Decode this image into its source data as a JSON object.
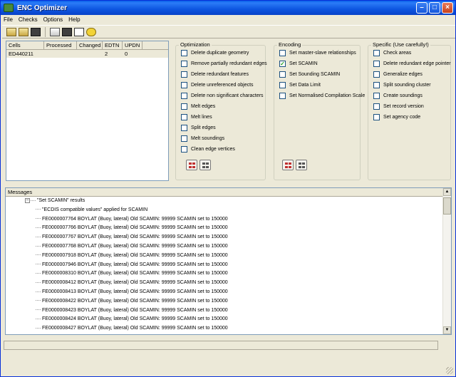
{
  "window": {
    "title": "ENC Optimizer"
  },
  "menu": [
    "File",
    "Checks",
    "Options",
    "Help"
  ],
  "toolbar": {
    "icons": [
      "open-folder-icon",
      "save-icon",
      "stop-icon",
      "run-checks-icon",
      "edit-icon",
      "arrows-icon",
      "help-icon"
    ]
  },
  "cells": {
    "columns": [
      "Cells",
      "Processed",
      "Changed",
      "EDTN",
      "UPDN"
    ],
    "rows": [
      {
        "cell": "ED440211",
        "processed": "",
        "changed": "",
        "edtn": "2",
        "updn": "0"
      }
    ]
  },
  "optimization": {
    "title": "Optimization",
    "options": [
      {
        "label": "Delete duplicate geometry",
        "checked": false
      },
      {
        "label": "Remove partially redundant edges",
        "checked": false
      },
      {
        "label": "Delete redundant features",
        "checked": false
      },
      {
        "label": "Delete unreferenced objects",
        "checked": false
      },
      {
        "label": "Delete non significant characters",
        "checked": false
      },
      {
        "label": "Melt edges",
        "checked": false
      },
      {
        "label": "Melt lines",
        "checked": false
      },
      {
        "label": "Split edges",
        "checked": false
      },
      {
        "label": "Melt soundings",
        "checked": false
      },
      {
        "label": "Clean edge vertices",
        "checked": false
      }
    ]
  },
  "encoding": {
    "title": "Encoding",
    "options": [
      {
        "label": "Set master-slave relationships",
        "checked": false
      },
      {
        "label": "Set SCAMIN",
        "checked": true
      },
      {
        "label": "Set Sounding SCAMIN",
        "checked": false
      },
      {
        "label": "Set Data Limit",
        "checked": false
      },
      {
        "label": "Set Normalised Compilation Scale",
        "checked": false
      }
    ]
  },
  "specific": {
    "title": "Specific (Use carefully!)",
    "options": [
      {
        "label": "Check areas",
        "checked": false
      },
      {
        "label": "Delete redundant edge pointer",
        "checked": false
      },
      {
        "label": "Generalize edges",
        "checked": false
      },
      {
        "label": "Split sounding cluster",
        "checked": false
      },
      {
        "label": "Create soundings",
        "checked": false
      },
      {
        "label": "Set record version",
        "checked": false
      },
      {
        "label": "Set agency code",
        "checked": false
      }
    ]
  },
  "messages": {
    "title": "Messages",
    "root": "\"Set SCAMIN\" results",
    "sub": "\"ECDIS compatible values\" applied for SCAMIN",
    "items": [
      "FE0000007764 BOYLAT (Buoy, lateral) Old SCAMIN: 99999 SCAMIN set to 150000",
      "FE0000007766 BOYLAT (Buoy, lateral) Old SCAMIN: 99999 SCAMIN set to 150000",
      "FE0000007767 BOYLAT (Buoy, lateral) Old SCAMIN: 99999 SCAMIN set to 150000",
      "FE0000007768 BOYLAT (Buoy, lateral) Old SCAMIN: 99999 SCAMIN set to 150000",
      "FE0000007918 BOYLAT (Buoy, lateral) Old SCAMIN: 99999 SCAMIN set to 150000",
      "FE0000007946 BOYLAT (Buoy, lateral) Old SCAMIN: 99999 SCAMIN set to 150000",
      "FE0000008310 BOYLAT (Buoy, lateral) Old SCAMIN: 99999 SCAMIN set to 150000",
      "FE0000008412 BOYLAT (Buoy, lateral) Old SCAMIN: 99999 SCAMIN set to 150000",
      "FE0000008413 BOYLAT (Buoy, lateral) Old SCAMIN: 99999 SCAMIN set to 150000",
      "FE0000008422 BOYLAT (Buoy, lateral) Old SCAMIN: 99999 SCAMIN set to 150000",
      "FE0000008423 BOYLAT (Buoy, lateral) Old SCAMIN: 99999 SCAMIN set to 150000",
      "FE0000008424 BOYLAT (Buoy, lateral) Old SCAMIN: 99999 SCAMIN set to 150000",
      "FE0000008427 BOYLAT (Buoy, lateral) Old SCAMIN: 99999 SCAMIN set to 150000"
    ]
  },
  "colors": {
    "titlebar": "#0a5fe8",
    "face": "#ece9d8",
    "check": "#21a121"
  }
}
